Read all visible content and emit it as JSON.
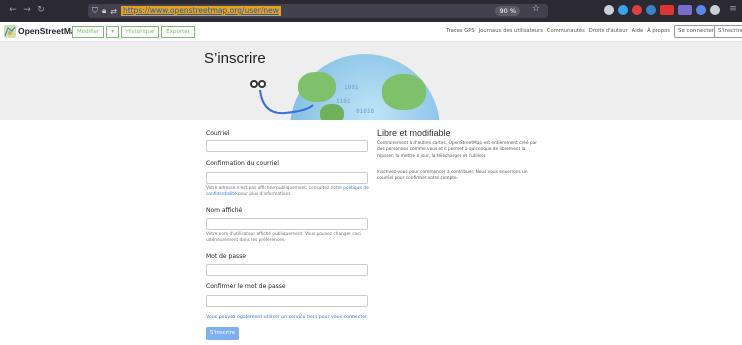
{
  "browser": {
    "back": "←",
    "forward": "→",
    "reload": "↻",
    "url": "https://www.openstreetmap.org/user/new",
    "zoom": "90 %",
    "star": "☆",
    "menu": "≡"
  },
  "header": {
    "brand": "OpenStreetMap",
    "edit_label": "Modifier",
    "dropdown": "▾",
    "history_label": "Historique",
    "export_label": "Exporter",
    "links": [
      "Traces GPS",
      "Journaux des utilisateurs",
      "Communautés",
      "Droits d'auteur",
      "Aide",
      "À propos"
    ],
    "login_label": "Se connecter",
    "signup_label": "S'inscrire"
  },
  "hero": {
    "title": "S’inscrire"
  },
  "form": {
    "email_label": "Courriel",
    "email_confirm_label": "Confirmation du courriel",
    "email_help_prefix": "Votre adresse n'est pas affichée publiquement, consultez notre ",
    "email_help_link": "politique de confidentialité",
    "email_help_suffix": " pour plus d'informations.",
    "display_name_label": "Nom affiché",
    "display_name_help": "Votre nom d'utilisateur affiché publiquement. Vous pouvez changer ceci ultérieurement dans les préférences.",
    "password_label": "Mot de passe",
    "password_confirm_label": "Confirmer le mot de passe",
    "third_party": "Vous pouvez également utiliser un service tiers pour vous connecter.",
    "submit_label": "S'inscrire"
  },
  "info": {
    "title": "Libre et modifiable",
    "para1": "Contrairement à d'autres cartes, OpenStreetMap est entièrement créé par des personnes comme vous et il permet à quiconque de librement la réparer, la mettre à jour, la télécharger et l'utiliser.",
    "para2": "Inscrivez-vous pour commencer à contribuer. Nous vous enverrons un courriel pour confirmer votre compte."
  },
  "colors": {
    "osm_green": "#7ebc6f",
    "link_blue": "#2b78d0",
    "button_blue": "#7eaff0",
    "browser_dark": "#2b2a33"
  }
}
